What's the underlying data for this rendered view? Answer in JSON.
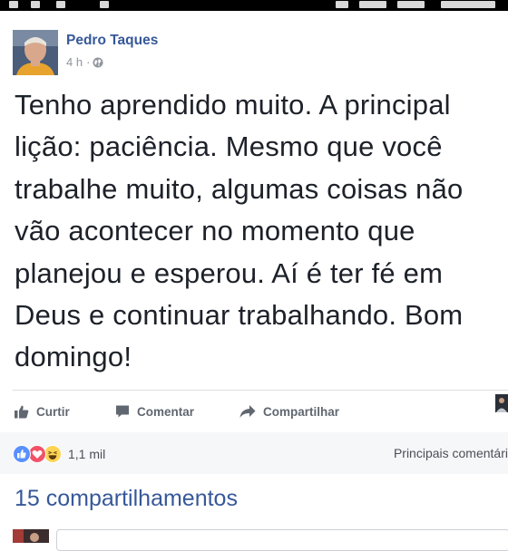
{
  "post": {
    "author": "Pedro Taques",
    "time": "4 h",
    "separator": "·",
    "text": "Tenho aprendido muito. A principal lição: paciência. Mesmo que você trabalhe muito, algumas coisas não vão acontecer no momento que planejou e esperou. Aí é ter fé em Deus e continuar trabalhando. Bom domingo!"
  },
  "actions": {
    "like": "Curtir",
    "comment": "Comentar",
    "share": "Compartilhar"
  },
  "reactions": {
    "icons": [
      "like-reaction-icon",
      "love-reaction-icon",
      "haha-reaction-icon"
    ],
    "count": "1,1 mil",
    "top_comments": "Principais comentári"
  },
  "shares": "15 compartilhamentos",
  "comment": {
    "placeholder": ""
  },
  "colors": {
    "author_link": "#365899",
    "body_text": "#1d2129",
    "action_text": "#606770",
    "like_blue": "#5890ff",
    "love_red": "#f25268",
    "haha_yellow": "#fcd353"
  }
}
